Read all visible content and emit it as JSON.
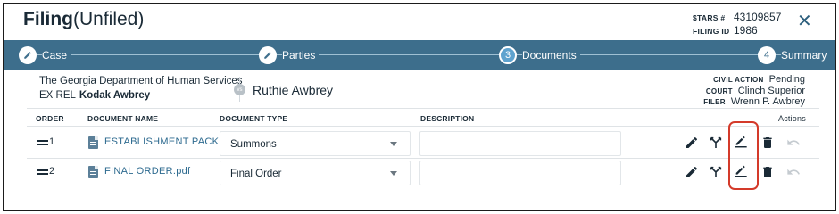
{
  "header": {
    "title_bold": "Filing",
    "title_light": "(Unfiled)",
    "stars_label": "$TARS #",
    "stars_value": "43109857",
    "filing_id_label": "FILING ID",
    "filing_id_value": "1986",
    "close_icon": "close-icon"
  },
  "stepper": {
    "steps": [
      {
        "marker": "pencil-icon",
        "label": "Case"
      },
      {
        "marker": "pencil-icon",
        "label": "Parties"
      },
      {
        "marker": "3",
        "label": "Documents",
        "active": true
      },
      {
        "marker": "4",
        "label": "Summary"
      }
    ]
  },
  "parties": {
    "plaintiff": "The Georgia Department of Human Services",
    "ex_rel_label": "EX REL",
    "ex_rel_name": "Kodak Awbrey",
    "vs": "vs",
    "defendant": "Ruthie Awbrey"
  },
  "case_info": {
    "civil_action_label": "CIVIL ACTION",
    "civil_action_value": "Pending",
    "court_label": "COURT",
    "court_value": "Clinch Superior",
    "filer_label": "FILER",
    "filer_value": "Wrenn P. Awbrey"
  },
  "table": {
    "headers": {
      "order": "ORDER",
      "document_name": "DOCUMENT NAME",
      "document_type": "DOCUMENT TYPE",
      "description": "DESCRIPTION",
      "actions": "Actions"
    },
    "rows": [
      {
        "order": "1",
        "name": "ESTABLISHMENT PACKE...",
        "type": "Summons",
        "description": ""
      },
      {
        "order": "2",
        "name": "FINAL ORDER.pdf",
        "type": "Final Order",
        "description": ""
      }
    ],
    "action_icons": [
      "pencil-icon",
      "merge-icon",
      "edit-underline-icon",
      "trash-icon",
      "undo-icon"
    ]
  },
  "colors": {
    "stepper_bg": "#3d6e8c",
    "active_step": "#5fa3cf",
    "link": "#2d6a8f",
    "highlight": "#d43a2a"
  }
}
